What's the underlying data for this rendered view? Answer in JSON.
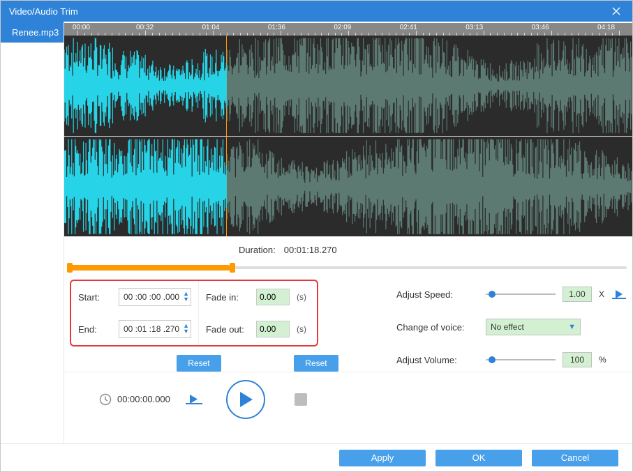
{
  "title": "Video/Audio Trim",
  "sidebar": {
    "items": [
      "Renee.mp3"
    ]
  },
  "ruler": {
    "labels": [
      "00:00",
      "00:32",
      "01:04",
      "01:36",
      "02:09",
      "02:41",
      "03:13",
      "03:46",
      "04:18"
    ]
  },
  "duration": {
    "label": "Duration:",
    "value": "00:01:18.270"
  },
  "selection": {
    "start_pct": 0,
    "end_pct": 28.6
  },
  "trim": {
    "start_label": "Start:",
    "start_value": "00 :00 :00 .000",
    "end_label": "End:",
    "end_value": "00 :01 :18 .270",
    "fadein_label": "Fade in:",
    "fadein_value": "0.00",
    "fadeout_label": "Fade out:",
    "fadeout_value": "0.00",
    "sec_unit": "(s)",
    "reset_label": "Reset"
  },
  "adjust": {
    "speed_label": "Adjust Speed:",
    "speed_value": "1.00",
    "speed_x": "X",
    "voice_label": "Change of voice:",
    "voice_value": "No effect",
    "volume_label": "Adjust Volume:",
    "volume_value": "100",
    "volume_unit": "%"
  },
  "transport": {
    "timecode": "00:00:00.000"
  },
  "footer": {
    "apply": "Apply",
    "ok": "OK",
    "cancel": "Cancel"
  }
}
